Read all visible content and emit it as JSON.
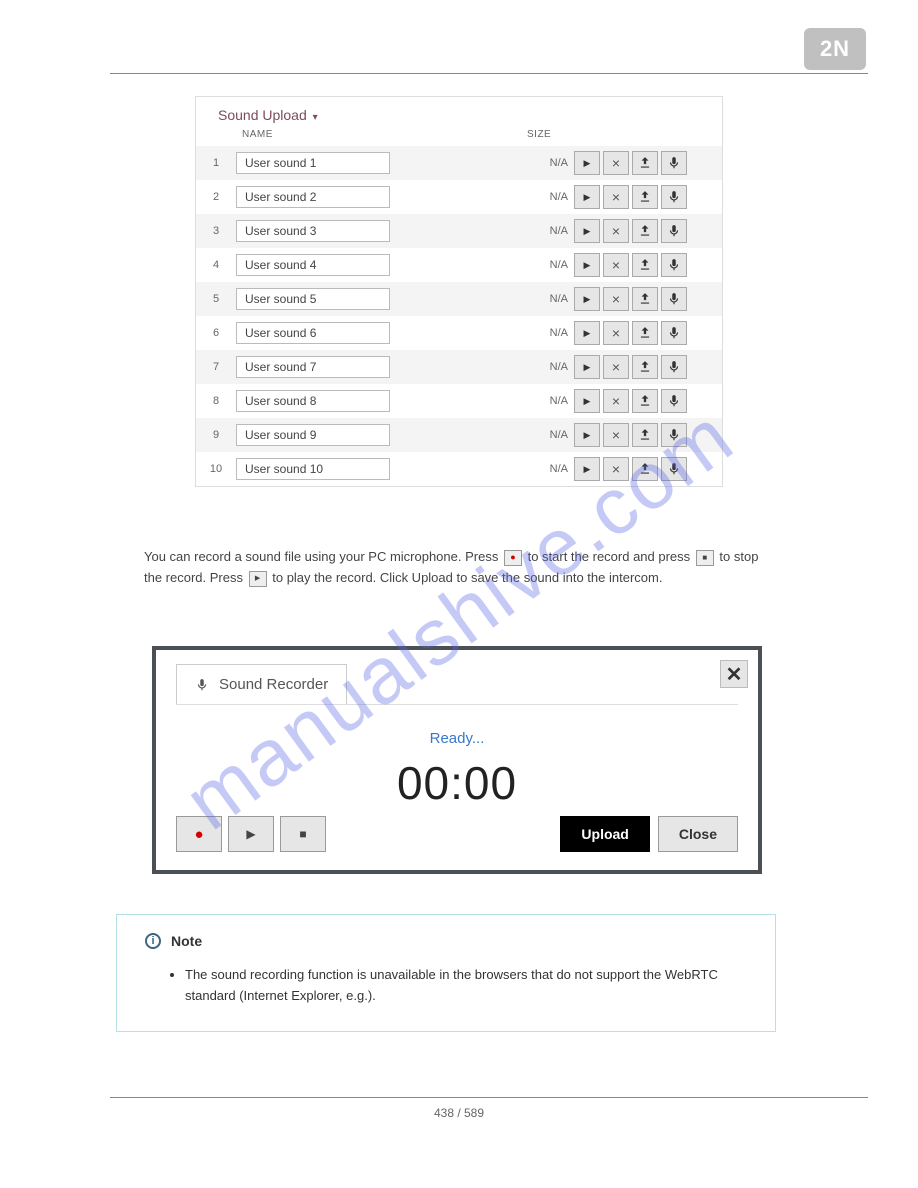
{
  "logo": "2N",
  "panel": {
    "title": "Sound Upload",
    "columns": {
      "name": "NAME",
      "size": "SIZE"
    },
    "rows": [
      {
        "idx": "1",
        "name": "User sound 1",
        "size": "N/A"
      },
      {
        "idx": "2",
        "name": "User sound 2",
        "size": "N/A"
      },
      {
        "idx": "3",
        "name": "User sound 3",
        "size": "N/A"
      },
      {
        "idx": "4",
        "name": "User sound 4",
        "size": "N/A"
      },
      {
        "idx": "5",
        "name": "User sound 5",
        "size": "N/A"
      },
      {
        "idx": "6",
        "name": "User sound 6",
        "size": "N/A"
      },
      {
        "idx": "7",
        "name": "User sound 7",
        "size": "N/A"
      },
      {
        "idx": "8",
        "name": "User sound 8",
        "size": "N/A"
      },
      {
        "idx": "9",
        "name": "User sound 9",
        "size": "N/A"
      },
      {
        "idx": "10",
        "name": "User sound 10",
        "size": "N/A"
      }
    ],
    "icons": {
      "play": "play-icon",
      "delete": "delete-icon",
      "upload": "upload-icon",
      "mic": "mic-icon"
    }
  },
  "para": {
    "t1": "You can record a sound file using your PC microphone. Press ",
    "t2": " to start the record and press ",
    "t3": " to stop the record. Press ",
    "t4": " to play the record. Click Upload to save the sound into the intercom."
  },
  "recorder": {
    "tab": "Sound Recorder",
    "status": "Ready...",
    "timer": "00:00",
    "upload": "Upload",
    "close": "Close"
  },
  "note": {
    "title": "Note",
    "bullet": "The sound recording function is unavailable in the browsers that do not support the WebRTC standard (Internet Explorer, e.g.)."
  },
  "footer": "438 / 589",
  "watermark": "manualshive.com"
}
